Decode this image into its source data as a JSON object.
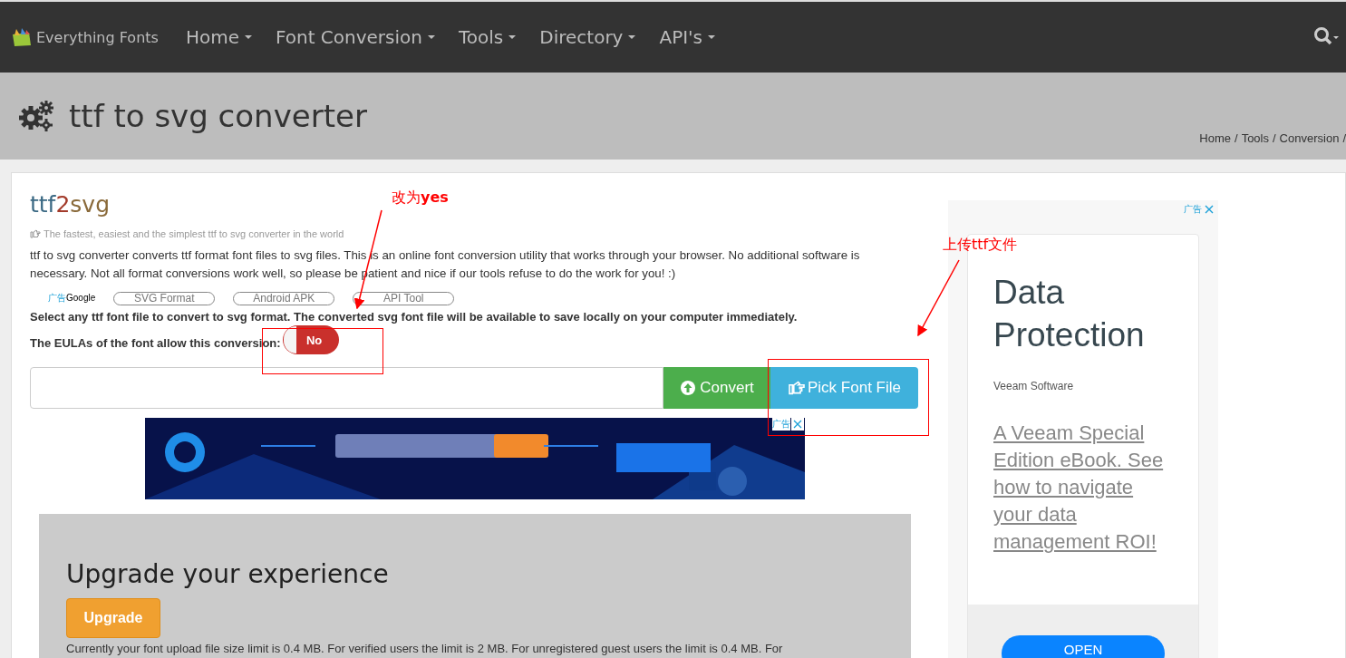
{
  "navbar": {
    "brand": "Everything Fonts",
    "menu": [
      {
        "label": "Home"
      },
      {
        "label": "Font Conversion"
      },
      {
        "label": "Tools"
      },
      {
        "label": "Directory"
      },
      {
        "label": "API's"
      }
    ]
  },
  "header": {
    "title": "ttf to svg converter",
    "breadcrumb": {
      "items": [
        "Home",
        "Tools",
        "Conversion"
      ],
      "separator": "/"
    }
  },
  "tool": {
    "name_parts": [
      {
        "text": "ttf",
        "color": "#3a6883"
      },
      {
        "text": "2",
        "color": "#a33b2b"
      },
      {
        "text": "svg",
        "color": "#8a6a3a"
      }
    ],
    "tagline": "The fastest, easiest and the simplest ttf to svg converter in the world",
    "description": "ttf to svg converter converts ttf format font files to svg files. This is an online font conversion utility that works through your browser. No additional software is necessary. Not all format conversions work well, so please be patient and nice if our tools refuse to do the work for you! :)",
    "ad_label": "广告",
    "ad_provider": "Google",
    "links": [
      "SVG Format",
      "Android APK",
      "API Tool"
    ],
    "instruction": "Select any ttf font file to convert to svg format. The converted svg font file will be available to save locally on your computer immediately.",
    "eula": {
      "label": "The EULAs of the font allow this conversion:",
      "on": false,
      "state_text": "No"
    },
    "convert_button": "Convert",
    "pick_button": "Pick Font File",
    "banner": {
      "ad_label": "广告",
      "kind": "picture"
    }
  },
  "upgrade": {
    "heading": "Upgrade your experience",
    "button": "Upgrade",
    "text": "Currently your font upload file size limit is 0.4 MB. For verified users the limit is 2 MB. For unregistered guest users the limit is 0.4 MB. For"
  },
  "side_ad": {
    "ad_label": "广告",
    "title": "Data Protection",
    "advertiser": "Veeam Software",
    "link": "A Veeam Special Edition eBook. See how to navigate your data management ROI!",
    "button": "OPEN"
  },
  "annotations": [
    {
      "kind": "note",
      "text": "改为**yes**"
    },
    {
      "kind": "note",
      "text": "上传ttf文件"
    }
  ]
}
